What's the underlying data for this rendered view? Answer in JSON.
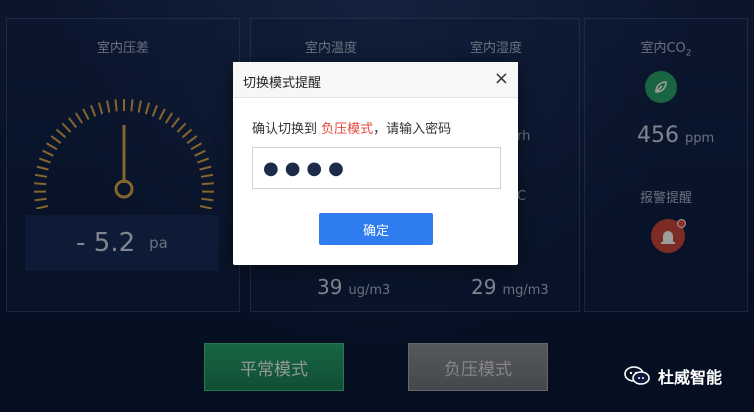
{
  "panels": {
    "pressure": {
      "label": "室内压差",
      "value": "- 5.2",
      "unit": "pa"
    },
    "temperature": {
      "label": "室内温度"
    },
    "humidity": {
      "label": "室内湿度",
      "unit_stub": "rh"
    },
    "co2": {
      "label": "室内CO",
      "label_sub": "2",
      "value": "456",
      "unit": "ppm"
    },
    "alarm": {
      "label": "报警提醒"
    },
    "pm25": {
      "value": "39",
      "unit": "ug/m3"
    },
    "pm10": {
      "value": "29",
      "unit": "mg/m3"
    },
    "c_stub": "C"
  },
  "buttons": {
    "normal": "平常模式",
    "negative": "负压模式"
  },
  "modal": {
    "title": "切换模式提醒",
    "message_pre": "确认切换到 ",
    "mode": "负压模式",
    "message_post": "，请输入密码",
    "password_value": "●●●●",
    "confirm": "确定"
  },
  "watermark": {
    "text": "杜威智能"
  },
  "colors": {
    "accent": "#2f7cf0",
    "green": "#27a36d",
    "warning": "#e5483b",
    "gauge": "#d8a24a"
  }
}
